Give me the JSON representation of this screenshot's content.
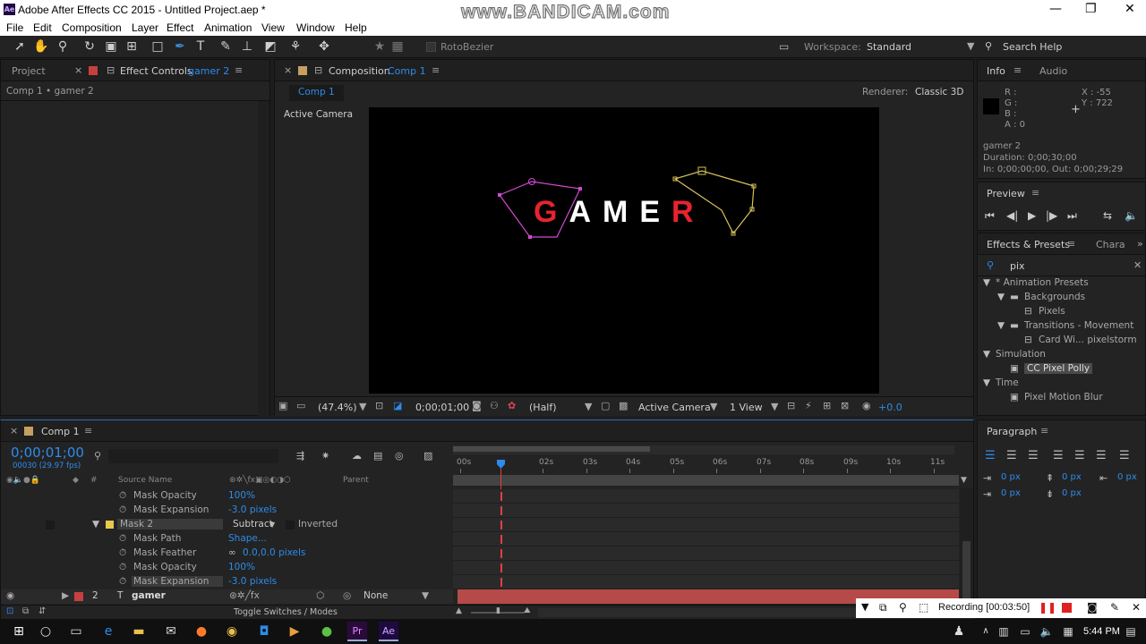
{
  "window": {
    "title": "Adobe After Effects CC 2015 - Untitled Project.aep *",
    "watermark": "www.BANDICAM.com"
  },
  "menu": [
    "File",
    "Edit",
    "Composition",
    "Layer",
    "Effect",
    "Animation",
    "View",
    "Window",
    "Help"
  ],
  "toolbar": {
    "rotobezier": "RotoBezier",
    "workspace_label": "Workspace:",
    "workspace_value": "Standard",
    "search_help": "Search Help"
  },
  "left_panel": {
    "tab_project": "Project",
    "tab_effect": "Effect Controls",
    "tab_effect_target": "gamer 2",
    "breadcrumb": "Comp 1 • gamer 2"
  },
  "comp_panel": {
    "tab_label": "Composition",
    "tab_target": "Comp 1",
    "subtab": "Comp 1",
    "renderer_label": "Renderer:",
    "renderer_value": "Classic 3D",
    "active_camera": "Active Camera",
    "logo_text": "GAMER",
    "footer": {
      "zoom": "(47.4%)",
      "timecode": "0;00;01;00",
      "resolution": "(Half)",
      "camera": "Active Camera",
      "views": "1 View",
      "exposure": "+0.0"
    }
  },
  "info_panel": {
    "tab_info": "Info",
    "tab_audio": "Audio",
    "r": "R :",
    "g": "G :",
    "b": "B :",
    "a": "A : 0",
    "x": "X : -55",
    "y": "Y : 722",
    "layer": "gamer 2",
    "duration": "Duration: 0;00;30;00",
    "inout": "In: 0;00;00;00, Out: 0;00;29;29"
  },
  "preview_panel": {
    "title": "Preview"
  },
  "effects_panel": {
    "tab": "Effects & Presets",
    "tab2": "Chara",
    "search": "pix",
    "tree": [
      {
        "label": "* Animation Presets",
        "indent": 0,
        "kind": "folder-open"
      },
      {
        "label": "Backgrounds",
        "indent": 1,
        "kind": "folder-open"
      },
      {
        "label": "Pixels",
        "indent": 2,
        "kind": "preset"
      },
      {
        "label": "Transitions - Movement",
        "indent": 1,
        "kind": "folder-open"
      },
      {
        "label": "Card Wi... pixelstorm",
        "indent": 2,
        "kind": "preset"
      },
      {
        "label": "Simulation",
        "indent": 0,
        "kind": "folder-open"
      },
      {
        "label": "CC Pixel Polly",
        "indent": 1,
        "kind": "effect",
        "selected": true
      },
      {
        "label": "Time",
        "indent": 0,
        "kind": "folder-open"
      },
      {
        "label": "Pixel Motion Blur",
        "indent": 1,
        "kind": "effect"
      }
    ]
  },
  "paragraph_panel": {
    "title": "Paragraph",
    "values": [
      "0 px",
      "0 px",
      "0 px",
      "0 px",
      "0 px"
    ]
  },
  "timeline": {
    "tab": "Comp 1",
    "timecode": "0;00;01;00",
    "fps": "00030 (29.97 fps)",
    "col_source": "Source Name",
    "col_parent": "Parent",
    "ruler": [
      "00s",
      "02s",
      "03s",
      "04s",
      "05s",
      "06s",
      "07s",
      "08s",
      "09s",
      "10s",
      "11s"
    ],
    "rows": [
      {
        "name": "Mask Opacity",
        "value": "100%"
      },
      {
        "name": "Mask Expansion",
        "value": "-3.0 pixels"
      },
      {
        "name": "Mask 2",
        "mode": "Subtract",
        "inverted": "Inverted"
      },
      {
        "name": "Mask Path",
        "value": "Shape..."
      },
      {
        "name": "Mask Feather",
        "value": "0.0,0.0 pixels"
      },
      {
        "name": "Mask Opacity",
        "value": "100%"
      },
      {
        "name": "Mask Expansion",
        "value": "-3.0 pixels"
      }
    ],
    "layer": {
      "num": "2",
      "name": "gamer",
      "parent": "None"
    },
    "footer": "Toggle Switches / Modes"
  },
  "recording": {
    "label": "Recording [00:03:50]"
  },
  "taskbar": {
    "time": "5:44 PM"
  },
  "colors": {
    "accent": "#2d8ceb",
    "red": "#e8232f",
    "timeline_layer": "#b64a48"
  }
}
